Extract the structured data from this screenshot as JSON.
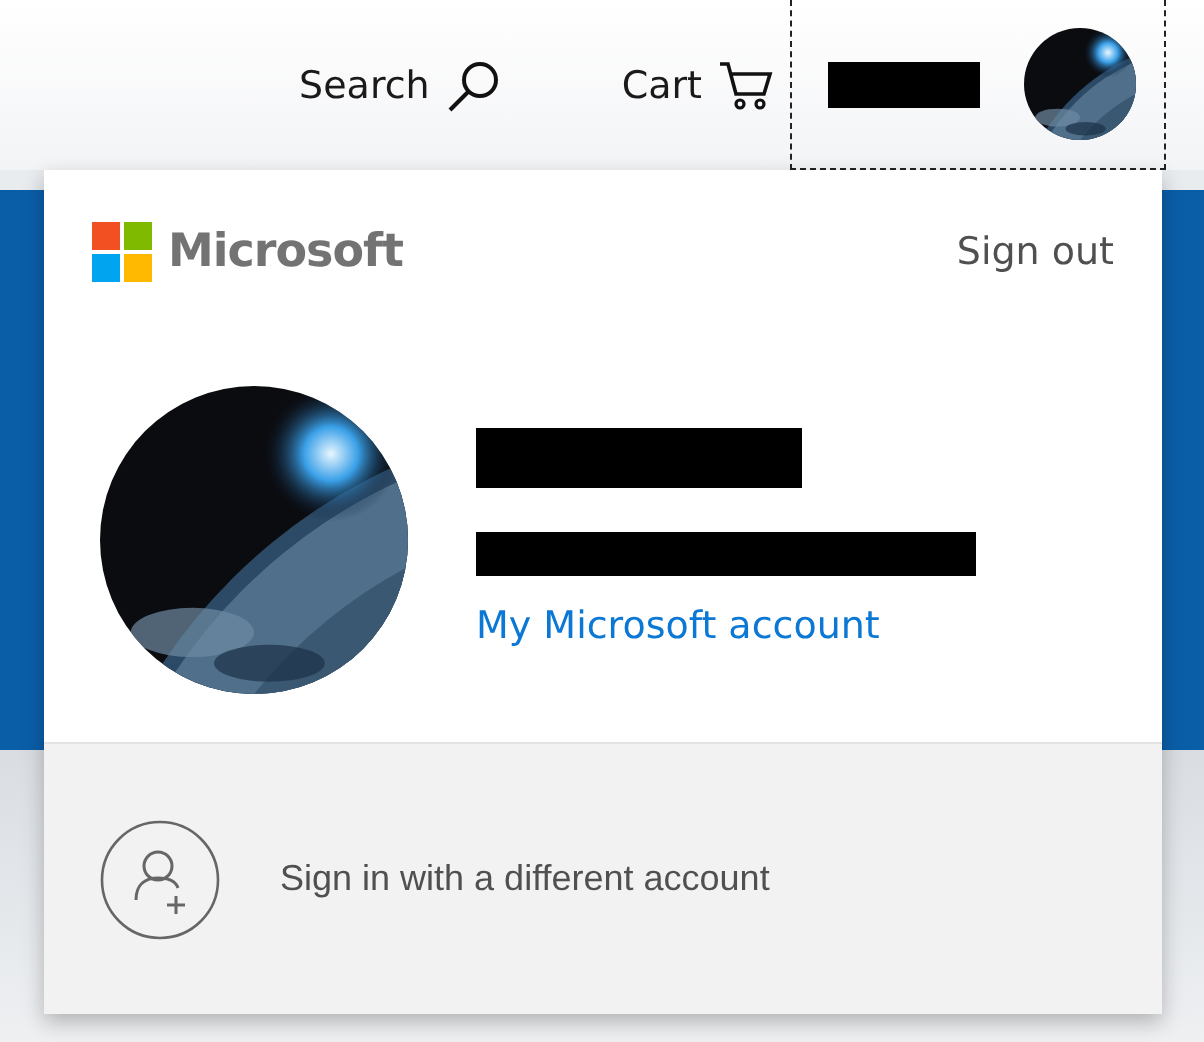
{
  "header": {
    "search": {
      "label": "Search"
    },
    "cart": {
      "label": "Cart"
    }
  },
  "account_menu": {
    "brand": "Microsoft",
    "sign_out": "Sign out",
    "account_link": "My Microsoft account",
    "switch_account": "Sign in with a different account"
  }
}
